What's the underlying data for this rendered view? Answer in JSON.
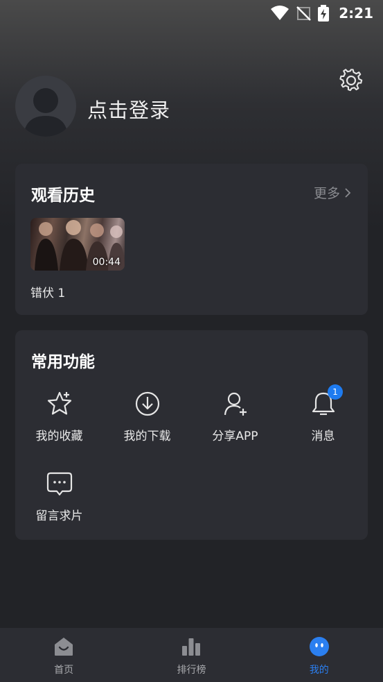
{
  "status_bar": {
    "time": "2:21"
  },
  "profile": {
    "login_label": "点击登录"
  },
  "history": {
    "title": "观看历史",
    "more_label": "更多",
    "items": [
      {
        "title": "错伏 1",
        "duration": "00:44"
      }
    ]
  },
  "functions": {
    "title": "常用功能",
    "items": [
      {
        "label": "我的收藏",
        "icon": "star-icon"
      },
      {
        "label": "我的下载",
        "icon": "download-icon"
      },
      {
        "label": "分享APP",
        "icon": "add-user-icon"
      },
      {
        "label": "消息",
        "icon": "bell-icon",
        "badge": "1"
      },
      {
        "label": "留言求片",
        "icon": "chat-bubble-icon"
      }
    ]
  },
  "bottom_nav": {
    "items": [
      {
        "label": "首页",
        "icon": "home-icon"
      },
      {
        "label": "排行榜",
        "icon": "bar-chart-icon"
      },
      {
        "label": "我的",
        "icon": "smiley-face-icon",
        "active": true
      }
    ]
  },
  "colors": {
    "accent": "#2b7ff0",
    "card": "#2c2d33",
    "background": "#222327"
  }
}
